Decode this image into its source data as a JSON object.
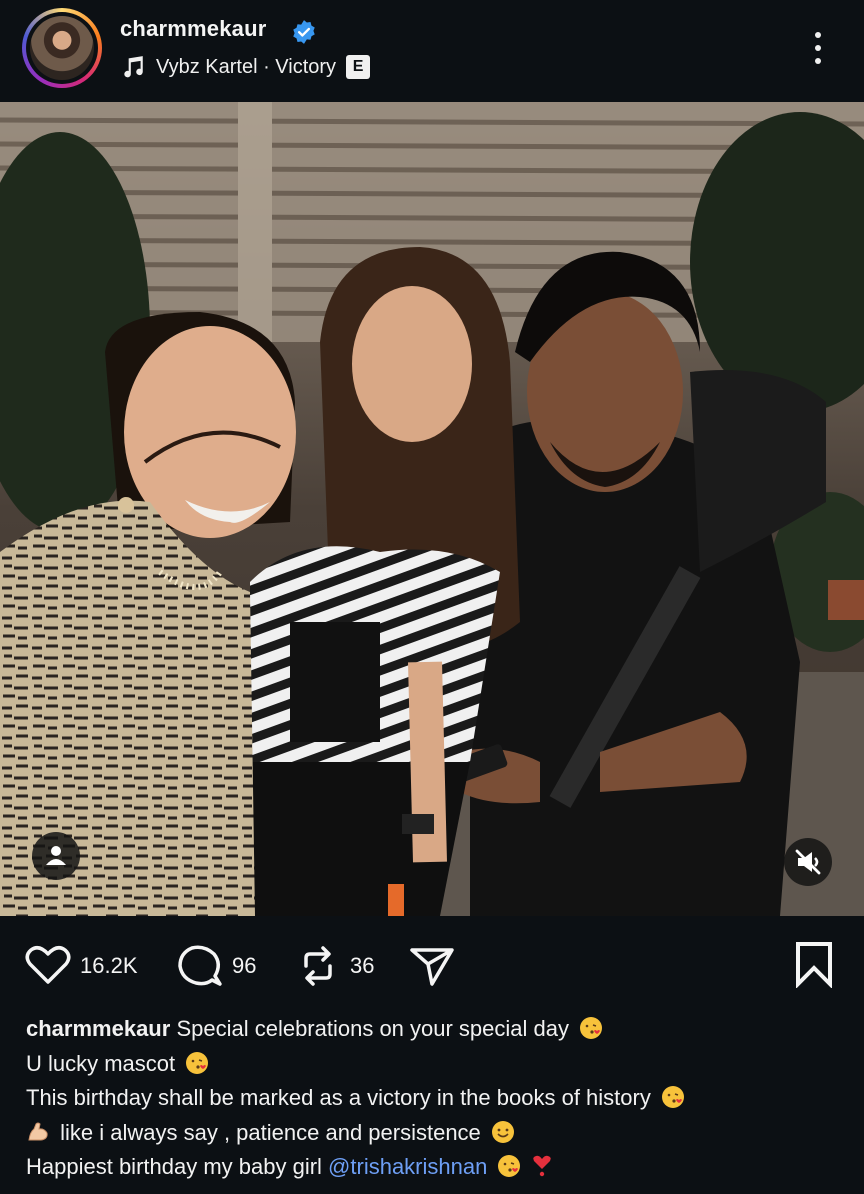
{
  "post": {
    "username": "charmmekaur",
    "audio": "Vybz Kartel · Victory",
    "explicit_badge": "E"
  },
  "actions": {
    "likes": "16.2K",
    "comments": "96",
    "reposts": "36"
  },
  "caption": {
    "username": "charmmekaur",
    "line1": "Special celebrations on your special day",
    "line2": "U lucky mascot",
    "line3": "This birthday shall be marked as a victory in the books of history",
    "line4": "like i always say , patience and persistence",
    "line5_prefix": "Happiest birthday my baby girl",
    "mention": "@trishakrishnan"
  },
  "colors": {
    "background": "#0c1014",
    "verified_blue": "#3897f0",
    "mention": "#6e9ff5"
  },
  "icons": [
    "verified-badge-icon",
    "music-note-icon",
    "more-options-icon",
    "heart-icon",
    "comment-icon",
    "repost-icon",
    "share-icon",
    "save-bookmark-icon",
    "tagged-user-icon",
    "mute-icon"
  ]
}
